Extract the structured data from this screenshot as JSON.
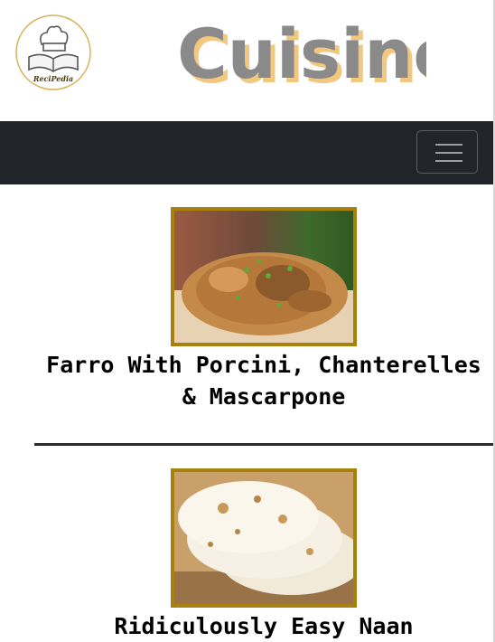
{
  "header": {
    "logo_text": "ReciPedia",
    "brand": "Cuisine"
  },
  "navbar": {
    "toggler_icon": "hamburger-menu-icon"
  },
  "recipes": [
    {
      "title": "Farro With Porcini, Chanterelles & Mascarpone",
      "image_alt": "farro with mushrooms"
    },
    {
      "title": "Ridiculously Easy Naan",
      "image_alt": "naan bread"
    }
  ],
  "colors": {
    "navbar": "#212529",
    "image_border": "#a7810e",
    "brand_fill": "#8a8a8a",
    "brand_shadow": "#f2c77e"
  }
}
